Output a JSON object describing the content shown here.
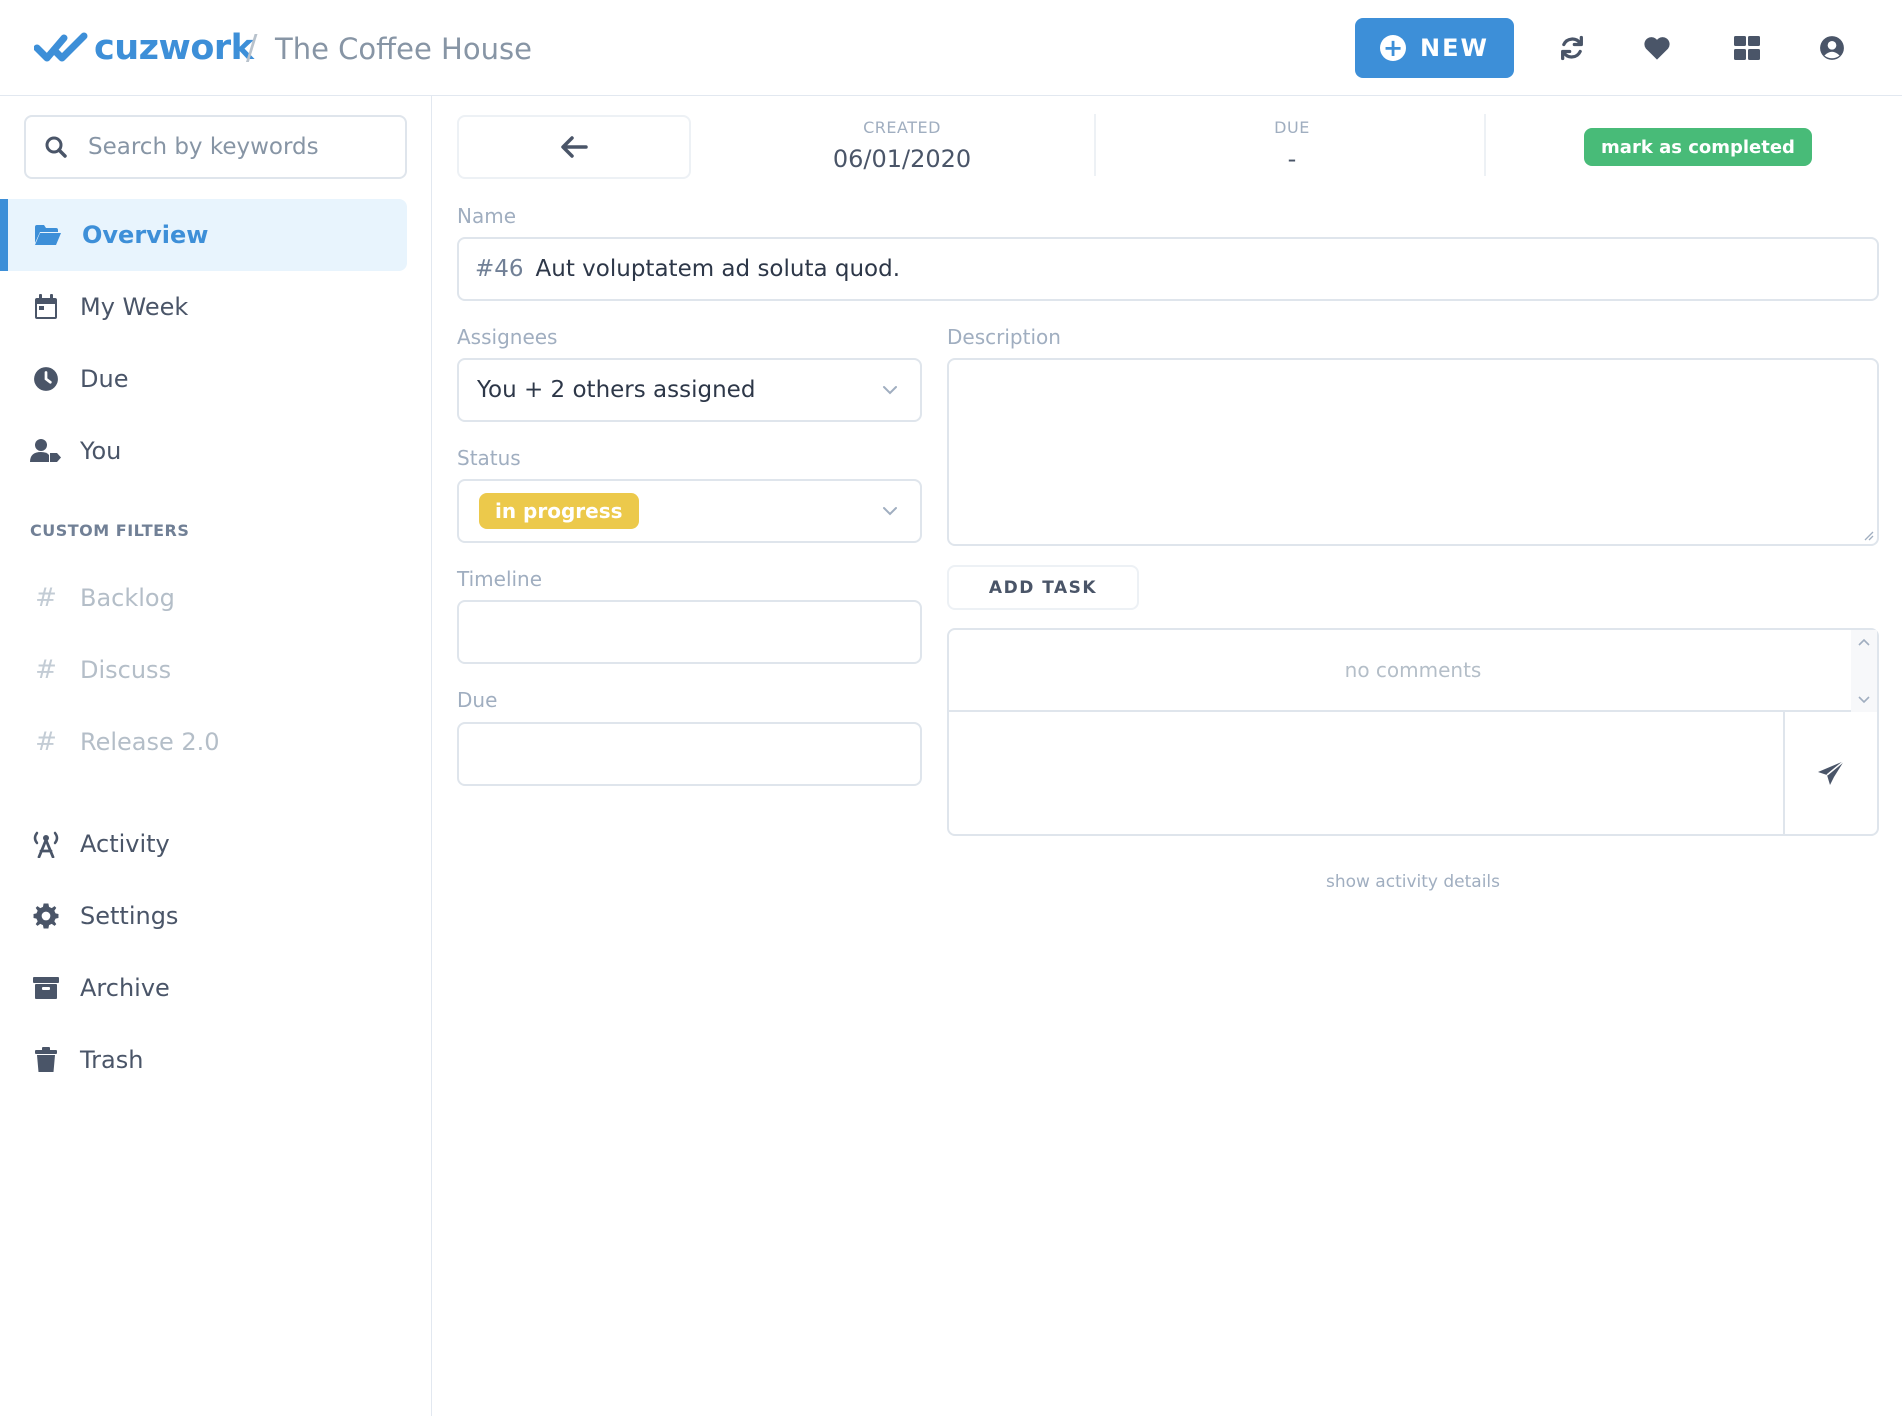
{
  "header": {
    "brand": "cuzwork",
    "separator": "/",
    "workspace": "The Coffee House",
    "new_label": "NEW",
    "new_icon": "plus-circle-icon",
    "icons": [
      "refresh-icon",
      "heart-icon",
      "grid-icon",
      "user-circle-icon"
    ]
  },
  "sidebar": {
    "search_placeholder": "Search by keywords",
    "items": [
      {
        "label": "Overview",
        "icon": "folder-open-icon"
      },
      {
        "label": "My Week",
        "icon": "calendar-icon"
      },
      {
        "label": "Due",
        "icon": "clock-icon"
      },
      {
        "label": "You",
        "icon": "user-tag-icon"
      }
    ],
    "custom_filters_label": "CUSTOM FILTERS",
    "filters": [
      {
        "label": "Backlog",
        "icon": "hash-icon"
      },
      {
        "label": "Discuss",
        "icon": "hash-icon"
      },
      {
        "label": "Release 2.0",
        "icon": "hash-icon"
      }
    ],
    "bottom_items": [
      {
        "label": "Activity",
        "icon": "broadcast-icon"
      },
      {
        "label": "Settings",
        "icon": "gear-icon"
      },
      {
        "label": "Archive",
        "icon": "archive-icon"
      },
      {
        "label": "Trash",
        "icon": "trash-icon"
      }
    ]
  },
  "task": {
    "created_label": "CREATED",
    "created_value": "06/01/2020",
    "due_label": "DUE",
    "due_value": "-",
    "complete_label": "mark as completed",
    "name_label": "Name",
    "number": "#46",
    "name": "Aut voluptatem ad soluta quod.",
    "assignees_label": "Assignees",
    "assignees_value": "You + 2 others assigned",
    "status_label": "Status",
    "status_value": "in progress",
    "timeline_label": "Timeline",
    "timeline_value": "",
    "due_field_label": "Due",
    "due_field_value": "",
    "description_label": "Description",
    "description_value": "",
    "add_task_label": "ADD TASK",
    "no_comments": "no comments",
    "comment_value": "",
    "activity_link": "show activity details"
  },
  "colors": {
    "brand": "#3d8fd8",
    "success": "#48bb78",
    "status_in_progress": "#ecc94b"
  }
}
